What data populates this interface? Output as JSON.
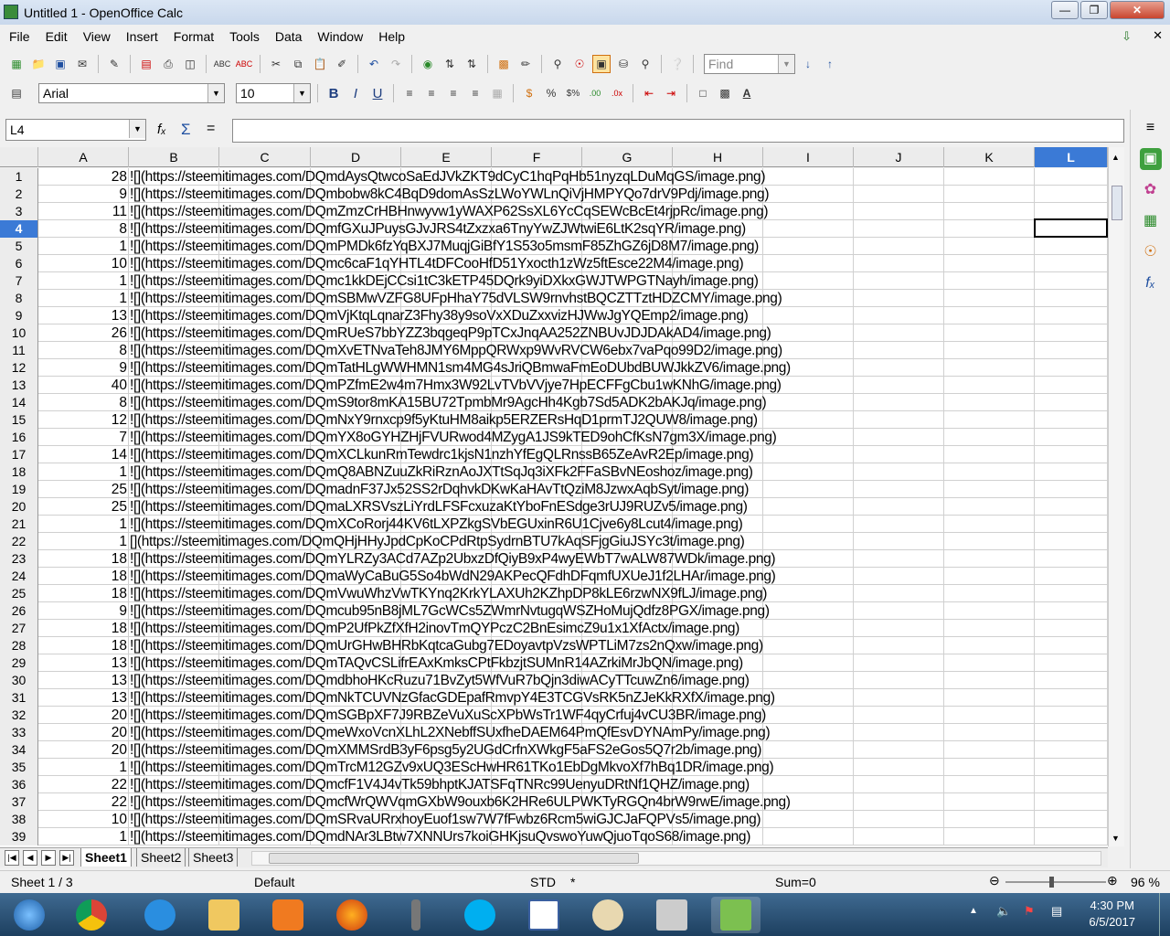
{
  "window": {
    "title": "Untitled 1 - OpenOffice Calc"
  },
  "menu": [
    "File",
    "Edit",
    "View",
    "Insert",
    "Format",
    "Tools",
    "Data",
    "Window",
    "Help"
  ],
  "toolbar": {
    "find_placeholder": "Find",
    "font_name": "Arial",
    "font_size": "10"
  },
  "formula_bar": {
    "name_box": "L4",
    "formula": ""
  },
  "columns": [
    "A",
    "B",
    "C",
    "D",
    "E",
    "F",
    "G",
    "H",
    "I",
    "J",
    "K",
    "L"
  ],
  "selected_cell": {
    "column": "L",
    "row": 4
  },
  "rows": [
    [
      28,
      "![](https://steemitimages.com/DQmdAysQtwcoSaEdJVkZKT9dCyC1hqPqHb51nyzqLDuMqGS/image.png)"
    ],
    [
      9,
      "![](https://steemitimages.com/DQmbobw8kC4BqD9domAsSzLWoYWLnQiVjHMPYQo7drV9Pdj/image.png)"
    ],
    [
      11,
      "![](https://steemitimages.com/DQmZmzCrHBHnwyvw1yWAXP62SsXL6YcCqSEWcBcEt4rjpRc/image.png)"
    ],
    [
      8,
      "![](https://steemitimages.com/DQmfGXuJPuysGJvJRS4tZxzxa6TnyYwZJWtwiE6LtK2sqYR/image.png)"
    ],
    [
      1,
      "![](https://steemitimages.com/DQmPMDk6fzYqBXJ7MuqjGiBfY1S53o5msmF85ZhGZ6jD8M7/image.png)"
    ],
    [
      10,
      "![](https://steemitimages.com/DQmc6caF1qYHTL4tDFCooHfD51Yxocth1zWz5ftEsce22M4/image.png)"
    ],
    [
      1,
      "![](https://steemitimages.com/DQmc1kkDEjCCsi1tC3kETP45DQrk9yiDXkxGWJTWPGTNayh/image.png)"
    ],
    [
      1,
      "![](https://steemitimages.com/DQmSBMwVZFG8UFpHhaY75dVLSW9rnvhstBQCZTTztHDZCMY/image.png)"
    ],
    [
      13,
      "![](https://steemitimages.com/DQmVjKtqLqnarZ3Fhy38y9soVxXDuZxxvizHJWwJgYQEmp2/image.png)"
    ],
    [
      26,
      "![](https://steemitimages.com/DQmRUeS7bbYZZ3bqgeqP9pTCxJnqAA252ZNBUvJDJDAkAD4/image.png)"
    ],
    [
      8,
      "![](https://steemitimages.com/DQmXvETNvaTeh8JMY6MppQRWxp9WvRVCW6ebx7vaPqo99D2/image.png)"
    ],
    [
      9,
      "![](https://steemitimages.com/DQmTatHLgWWHMN1sm4MG4sJriQBmwaFmEoDUbdBUWJkkZV6/image.png)"
    ],
    [
      40,
      "![](https://steemitimages.com/DQmPZfmE2w4m7Hmx3W92LvTVbVVjye7HpECFFgCbu1wKNhG/image.png)"
    ],
    [
      8,
      "![](https://steemitimages.com/DQmS9tor8mKA15BU72TpmbMr9AgcHh4Kgb7Sd5ADK2bAKJq/image.png)"
    ],
    [
      12,
      "![](https://steemitimages.com/DQmNxY9rnxcp9f5yKtuHM8aikp5ERZERsHqD1prmTJ2QUW8/image.png)"
    ],
    [
      7,
      "![](https://steemitimages.com/DQmYX8oGYHZHjFVURwod4MZygA1JS9kTED9ohCfKsN7gm3X/image.png)"
    ],
    [
      14,
      "![](https://steemitimages.com/DQmXCLkunRmTewdrc1kjsN1nzhYfEgQLRnssB65ZeAvR2Ep/image.png)"
    ],
    [
      1,
      "![](https://steemitimages.com/DQmQ8ABNZuuZkRiRznAoJXTtSqJq3iXFk2FFaSBvNEoshoz/image.png)"
    ],
    [
      25,
      "![](https://steemitimages.com/DQmadnF37Jx52SS2rDqhvkDKwKaHAvTtQziM8JzwxAqbSyt/image.png)"
    ],
    [
      25,
      "![](https://steemitimages.com/DQmaLXRSVszLiYrdLFSFcxuzaKtYboFnESdge3rUJ9RUZv5/image.png)"
    ],
    [
      1,
      "![](https://steemitimages.com/DQmXCoRorj44KV6tLXPZkgSVbEGUxinR6U1Cjve6y8Lcut4/image.png)"
    ],
    [
      1,
      "[](https://steemitimages.com/DQmQHjHHyJpdCpKoCPdRtpSydrnBTU7kAqSFjgGiuJSYc3t/image.png)"
    ],
    [
      18,
      "![](https://steemitimages.com/DQmYLRZy3ACd7AZp2UbxzDfQiyB9xP4wyEWbT7wALW87WDk/image.png)"
    ],
    [
      18,
      "![](https://steemitimages.com/DQmaWyCaBuG5So4bWdN29AKPecQFdhDFqmfUXUeJ1f2LHAr/image.png)"
    ],
    [
      18,
      "![](https://steemitimages.com/DQmVwuWhzVwTKYnq2KrkYLAXUh2KZhpDP8kLE6rzwNX9fLJ/image.png)"
    ],
    [
      9,
      "![](https://steemitimages.com/DQmcub95nB8jML7GcWCs5ZWmrNvtugqWSZHoMujQdfz8PGX/image.png)"
    ],
    [
      18,
      "![](https://steemitimages.com/DQmP2UfPkZfXfH2inovTmQYPczC2BnEsimcZ9u1x1XfActx/image.png)"
    ],
    [
      18,
      "![](https://steemitimages.com/DQmUrGHwBHRbKqtcaGubg7EDoyavtpVzsWPTLiM7zs2nQxw/image.png)"
    ],
    [
      13,
      "![](https://steemitimages.com/DQmTAQvCSLifrEAxKmksCPtFkbzjtSUMnR14AZrkiMrJbQN/image.png)"
    ],
    [
      13,
      "![](https://steemitimages.com/DQmdbhoHKcRuzu71BvZyt5WfVuR7bQjn3diwACyTTcuwZn6/image.png)"
    ],
    [
      13,
      "![](https://steemitimages.com/DQmNkTCUVNzGfacGDEpafRmvpY4E3TCGVsRK5nZJeKkRXfX/image.png)"
    ],
    [
      20,
      "![](https://steemitimages.com/DQmSGBpXF7J9RBZeVuXuScXPbWsTr1WF4qyCrfuj4vCU3BR/image.png)"
    ],
    [
      20,
      "![](https://steemitimages.com/DQmeWxoVcnXLhL2XNebffSUxfheDAEM64PmQfEsvDYNAmPy/image.png)"
    ],
    [
      20,
      "![](https://steemitimages.com/DQmXMMSrdB3yF6psg5y2UGdCrfnXWkgF5aFS2eGos5Q7r2b/image.png)"
    ],
    [
      1,
      "![](https://steemitimages.com/DQmTrcM12GZv9xUQ3EScHwHR61TKo1EbDgMkvoXf7hBq1DR/image.png)"
    ],
    [
      22,
      "![](https://steemitimages.com/DQmcfF1V4J4vTk59bhptKJATSFqTNRc99UenyuDRtNf1QHZ/image.png)"
    ],
    [
      22,
      "![](https://steemitimages.com/DQmcfWrQWVqmGXbW9ouxb6K2HRe6ULPWKTyRGQn4brW9rwE/image.png)"
    ],
    [
      10,
      "![](https://steemitimages.com/DQmSRvaURrxhoyEuof1sw7W7fFwbz6Rcm5wiGJCJaFQPVs5/image.png)"
    ],
    [
      1,
      "![](https://steemitimages.com/DQmdNAr3LBtw7XNNUrs7koiGHKjsuQvswoYuwQjuoTqoS68/image.png)"
    ]
  ],
  "sheets": [
    "Sheet1",
    "Sheet2",
    "Sheet3"
  ],
  "status": {
    "sheet": "Sheet 1 / 3",
    "style": "Default",
    "mode": "STD",
    "modified": "*",
    "sum": "Sum=0",
    "zoom": "96 %"
  },
  "taskbar": {
    "time": "4:30 PM",
    "date": "6/5/2017"
  }
}
